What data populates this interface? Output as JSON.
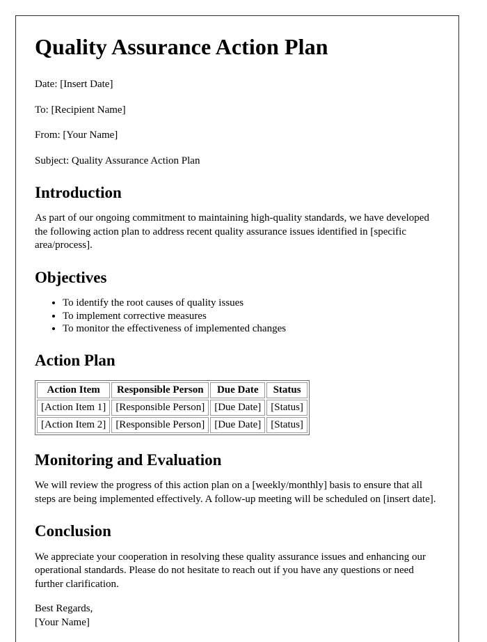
{
  "document": {
    "title": "Quality Assurance Action Plan",
    "meta": {
      "date": "Date: [Insert Date]",
      "to": "To: [Recipient Name]",
      "from": "From: [Your Name]",
      "subject": "Subject: Quality Assurance Action Plan"
    },
    "introduction": {
      "heading": "Introduction",
      "paragraph": "As part of our ongoing commitment to maintaining high-quality standards, we have developed the following action plan to address recent quality assurance issues identified in [specific area/process]."
    },
    "objectives": {
      "heading": "Objectives",
      "items": [
        "To identify the root causes of quality issues",
        "To implement corrective measures",
        "To monitor the effectiveness of implemented changes"
      ]
    },
    "action_plan": {
      "heading": "Action Plan",
      "columns": [
        "Action Item",
        "Responsible Person",
        "Due Date",
        "Status"
      ],
      "rows": [
        [
          "[Action Item 1]",
          "[Responsible Person]",
          "[Due Date]",
          "[Status]"
        ],
        [
          "[Action Item 2]",
          "[Responsible Person]",
          "[Due Date]",
          "[Status]"
        ]
      ]
    },
    "monitoring": {
      "heading": "Monitoring and Evaluation",
      "paragraph": "We will review the progress of this action plan on a [weekly/monthly] basis to ensure that all steps are being implemented effectively. A follow-up meeting will be scheduled on [insert date]."
    },
    "conclusion": {
      "heading": "Conclusion",
      "paragraph": "We appreciate your cooperation in resolving these quality assurance issues and enhancing our operational standards. Please do not hesitate to reach out if you have any questions or need further clarification."
    },
    "signoff": {
      "closing": "Best Regards,",
      "name": "[Your Name]"
    }
  },
  "colors": {
    "page_border": "#2b2b2b",
    "text": "#000000",
    "table_outer_border": "#6b6b6b",
    "table_cell_border": "#9a9a9a",
    "background": "#ffffff"
  }
}
